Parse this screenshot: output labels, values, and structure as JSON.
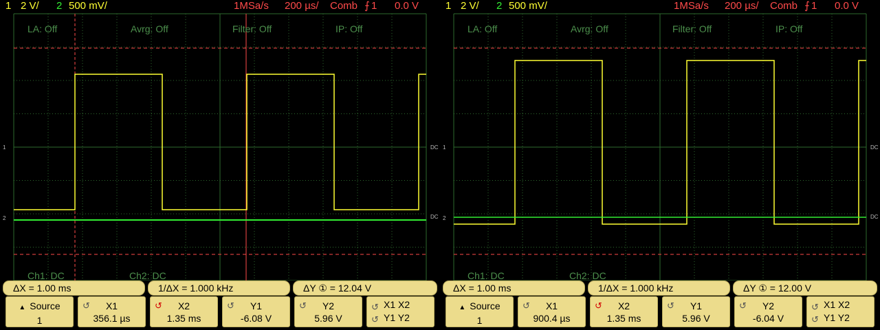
{
  "scopes": [
    {
      "status": {
        "ch1_num": "1",
        "ch1_scale": "2 V/",
        "ch2_num": "2",
        "ch2_scale": "500 mV/",
        "sample_rate": "1MSa/s",
        "timebase": "200 µs/",
        "mode": "Comb",
        "trigger_icon": "trigger-edge-icon",
        "trigger_source": "1",
        "trigger_level": "0.0 V"
      },
      "grid_labels": {
        "la": "LA: Off",
        "avrg": "Avrg: Off",
        "filter": "Filter: Off",
        "ip": "IP: Off",
        "ch1_coupling": "Ch1: DC",
        "ch2_coupling": "Ch2: DC"
      },
      "markers": {
        "ch1": "1",
        "ch2": "2",
        "dc1": "DC",
        "dc2": "DC"
      },
      "measurements": {
        "dx": "ΔX =  1.00 ms",
        "inv_dx": "1/ΔX =  1.000 kHz",
        "dy": "ΔY ① = 12.04  V"
      },
      "softkeys": [
        {
          "top": "Source",
          "bottom": "1",
          "icon": "menu-up-icon"
        },
        {
          "top": "X1",
          "bottom": "356.1 µs",
          "icon": "knob-icon"
        },
        {
          "top": "X2",
          "bottom": "1.35 ms",
          "icon": "knob-active-icon"
        },
        {
          "top": "Y1",
          "bottom": "-6.08  V",
          "icon": "knob-icon"
        },
        {
          "top": "Y2",
          "bottom": "5.96  V",
          "icon": "knob-icon"
        },
        {
          "top": "X1  X2",
          "bottom": "Y1  Y2",
          "icon": "knob-icon"
        }
      ]
    },
    {
      "status": {
        "ch1_num": "1",
        "ch1_scale": "2 V/",
        "ch2_num": "2",
        "ch2_scale": "500 mV/",
        "sample_rate": "1MSa/s",
        "timebase": "200 µs/",
        "mode": "Comb",
        "trigger_icon": "trigger-edge-icon",
        "trigger_source": "1",
        "trigger_level": "0.0 V"
      },
      "grid_labels": {
        "la": "LA: Off",
        "avrg": "Avrg: Off",
        "filter": "Filter: Off",
        "ip": "IP: Off",
        "ch1_coupling": "Ch1: DC",
        "ch2_coupling": "Ch2: DC"
      },
      "markers": {
        "ch1": "1",
        "ch2": "2",
        "dc1": "DC",
        "dc2": "DC"
      },
      "measurements": {
        "dx": "ΔX =  1.00 ms",
        "inv_dx": "1/ΔX =  1.000 kHz",
        "dy": "ΔY ① = 12.00  V"
      },
      "softkeys": [
        {
          "top": "Source",
          "bottom": "1",
          "icon": "menu-up-icon"
        },
        {
          "top": "X1",
          "bottom": "900.4 µs",
          "icon": "knob-icon"
        },
        {
          "top": "X2",
          "bottom": "1.35 ms",
          "icon": "knob-active-icon"
        },
        {
          "top": "Y1",
          "bottom": "5.96  V",
          "icon": "knob-icon"
        },
        {
          "top": "Y2",
          "bottom": "-6.04  V",
          "icon": "knob-icon"
        },
        {
          "top": "X1  X2",
          "bottom": "Y1  Y2",
          "icon": "knob-icon"
        }
      ]
    }
  ],
  "colors": {
    "ch1": "#ffff33",
    "ch2": "#33ee33",
    "cursor": "#ff4a4a",
    "grid": "#2e6a2e",
    "panel": "#ecdc8c"
  }
}
